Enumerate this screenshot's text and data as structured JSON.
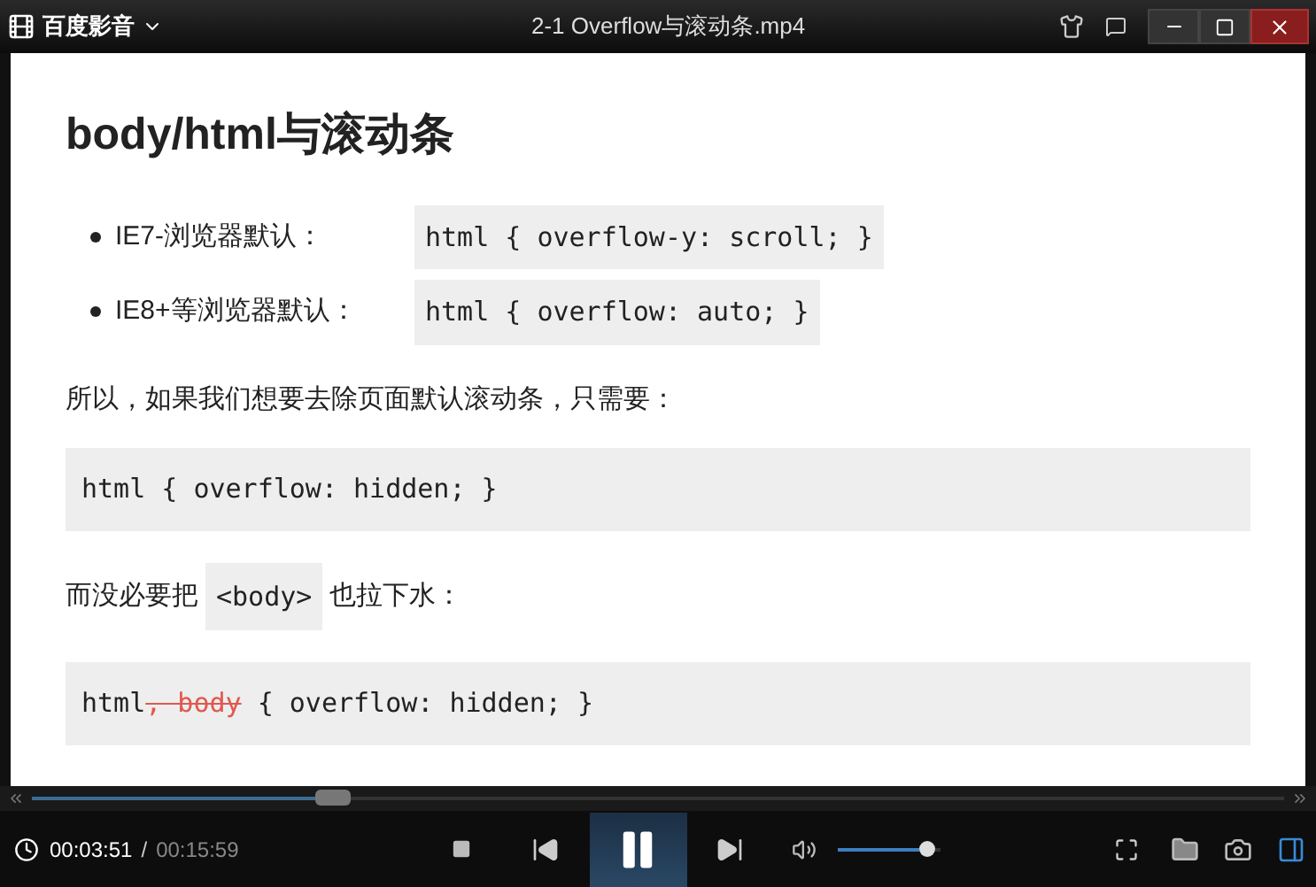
{
  "app": {
    "name": "百度影音",
    "title": "2-1 Overflow与滚动条.mp4"
  },
  "slide": {
    "heading": "body/html与滚动条",
    "bullets": [
      {
        "label": "IE7-浏览器默认：",
        "code": "html { overflow-y: scroll; }"
      },
      {
        "label": "IE8+等浏览器默认：",
        "code": "html { overflow: auto; }"
      }
    ],
    "paragraph": "所以，如果我们想要去除页面默认滚动条，只需要：",
    "code_block": "html { overflow: hidden; }",
    "line": {
      "before": "而没必要把",
      "code": "<body>",
      "after": "也拉下水："
    },
    "last_code": [
      {
        "text": "html",
        "struck": false
      },
      {
        "text": ", body",
        "struck": true
      },
      {
        "text": " { overflow: hidden; }",
        "struck": false
      }
    ]
  },
  "player": {
    "seek": {
      "level": 0.24
    },
    "current_time": "00:03:51",
    "separator": "/",
    "total_time": "00:15:59",
    "playing": true,
    "volume": {
      "level": 0.95
    }
  }
}
